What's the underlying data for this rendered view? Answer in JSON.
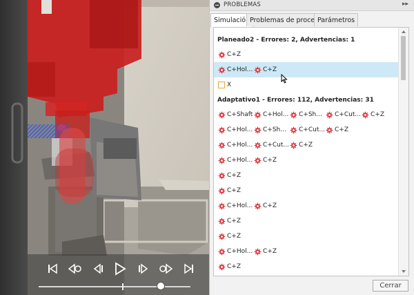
{
  "panel": {
    "title": "PROBLEMAS",
    "title_icon": "minus-circle-icon",
    "tabs": [
      "Simulación",
      "Problemas de proceso",
      "Parámetros"
    ],
    "close_label": "Cerrar"
  },
  "groups": [
    {
      "header": "Planeado2 - Errores: 2, Advertencias: 1",
      "rows": [
        {
          "selected": false,
          "items": [
            "C+Z"
          ]
        },
        {
          "selected": true,
          "items": [
            "C+Hol...",
            "C+Z"
          ]
        }
      ],
      "warning_rows": [
        {
          "label": "X"
        }
      ]
    },
    {
      "header": "Adaptativo1 - Errores: 112, Advertencias: 31",
      "rows": [
        {
          "items": [
            "C+Shaft",
            "C+Hol...",
            "C+Sh...",
            "C+Cut...",
            "C+Z"
          ]
        },
        {
          "items": [
            "C+Hol...",
            "C+Sh...",
            "C+Cut...",
            "C+Z"
          ]
        },
        {
          "items": [
            "C+Hol...",
            "C+Cut...",
            "C+Z"
          ]
        },
        {
          "items": [
            "C+Hol...",
            "C+Z"
          ]
        },
        {
          "items": [
            "C+Z"
          ]
        },
        {
          "items": [
            "C+Z"
          ]
        },
        {
          "items": [
            "C+Hol...",
            "C+Z"
          ]
        },
        {
          "items": [
            "C+Z"
          ]
        },
        {
          "items": [
            "C+Z"
          ]
        },
        {
          "items": [
            "C+Hol...",
            "C+Z"
          ]
        },
        {
          "items": [
            "C+Z"
          ]
        }
      ]
    }
  ],
  "playback": {
    "controls": [
      "skip-to-start-icon",
      "step-back-icon",
      "previous-icon",
      "play-icon",
      "next-icon",
      "step-forward-icon",
      "skip-to-end-icon"
    ],
    "progress_fraction": 0.86
  },
  "colors": {
    "error": "#d9313a",
    "warning": "#e8a33b",
    "selection": "#cde8f6",
    "machine_red": "#c9201e"
  }
}
